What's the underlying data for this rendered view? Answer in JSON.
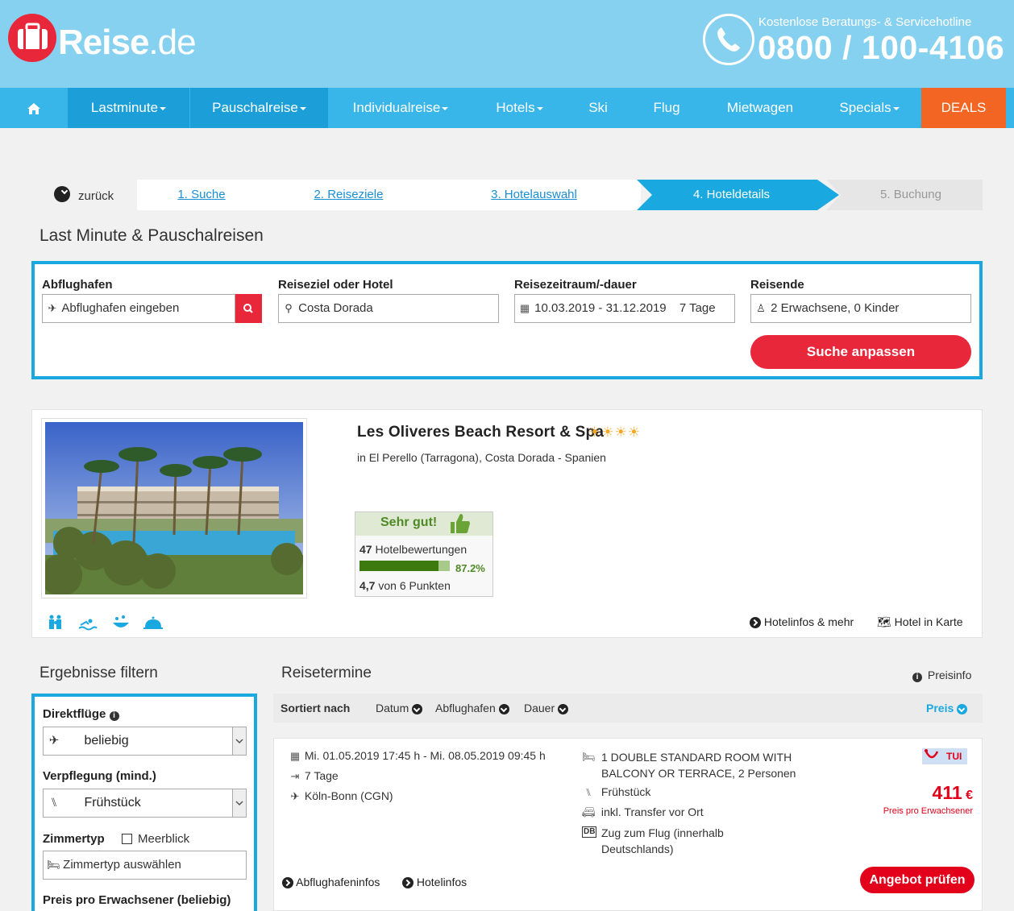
{
  "header": {
    "logo_main": "Reise",
    "logo_tld": ".de",
    "hotline_label": "Kostenlose Beratungs- & Servicehotline",
    "hotline_number": "0800 / 100-4106"
  },
  "nav": {
    "items": [
      {
        "label": "Lastminute"
      },
      {
        "label": "Pauschalreise"
      },
      {
        "label": "Individualreise"
      },
      {
        "label": "Hotels"
      },
      {
        "label": "Ski"
      },
      {
        "label": "Flug"
      },
      {
        "label": "Mietwagen"
      },
      {
        "label": "Specials"
      },
      {
        "label": "DEALS"
      }
    ]
  },
  "steps": {
    "back": "zurück",
    "s1": "1. Suche",
    "s2": "2. Reiseziele",
    "s3": "3. Hotelauswahl",
    "s4": "4. Hoteldetails",
    "s5": "5. Buchung"
  },
  "search": {
    "title": "Last Minute & Pauschalreisen",
    "airport_label": "Abflughafen",
    "airport_placeholder": "Abflughafen eingeben",
    "dest_label": "Reiseziel oder Hotel",
    "dest_value": "Costa Dorada",
    "period_label": "Reisezeitraum/-dauer",
    "period_dates": "10.03.2019 - 31.12.2019",
    "period_duration": "7 Tage",
    "travellers_label": "Reisende",
    "travellers_value": "2 Erwachsene, 0 Kinder",
    "submit": "Suche anpassen"
  },
  "hotel": {
    "name": "Les Oliveres Beach Resort & Spa",
    "stars": "☀☀☀☀",
    "location": "in El Perello (Tarragona), Costa Dorada - Spanien",
    "rating_label": "Sehr gut!",
    "reviews_count": "47",
    "reviews_label": "Hotelbewertungen",
    "rating_percent_text": "87.2%",
    "rating_fraction": 0.872,
    "points_value": "4,7",
    "points_label": "von 6 Punkten",
    "info_link": "Hotelinfos & mehr",
    "map_link": "Hotel in Karte"
  },
  "filters": {
    "title": "Ergebnisse filtern",
    "direct_label": "Direktflüge",
    "direct_value": "beliebig",
    "board_label": "Verpflegung (mind.)",
    "board_value": "Frühstück",
    "room_label": "Zimmertyp",
    "seaview_label": "Meerblick",
    "room_placeholder": "Zimmertyp auswählen",
    "price_label": "Preis pro Erwachsener (beliebig)"
  },
  "results": {
    "title": "Reisetermine",
    "price_info": "Preisinfo",
    "sorted_by": "Sortiert nach",
    "sort_date": "Datum",
    "sort_airport": "Abflughafen",
    "sort_duration": "Dauer",
    "sort_price": "Preis"
  },
  "offer": {
    "dates": "Mi. 01.05.2019 17:45 h - Mi. 08.05.2019 09:45 h",
    "duration": "7 Tage",
    "airport": "Köln-Bonn (CGN)",
    "room_line1": "1 DOUBLE STANDARD ROOM WITH",
    "room_line2": "BALCONY OR TERRACE, 2 Personen",
    "board": "Frühstück",
    "transfer": "inkl. Transfer vor Ort",
    "train_line1": "Zug zum Flug (innerhalb",
    "train_line2": "Deutschlands)",
    "operator": "TUI",
    "price": "411",
    "currency": "€",
    "price_note": "Preis pro Erwachsener",
    "airport_info": "Abflughafeninfos",
    "hotel_info": "Hotelinfos",
    "check": "Angebot prüfen"
  }
}
